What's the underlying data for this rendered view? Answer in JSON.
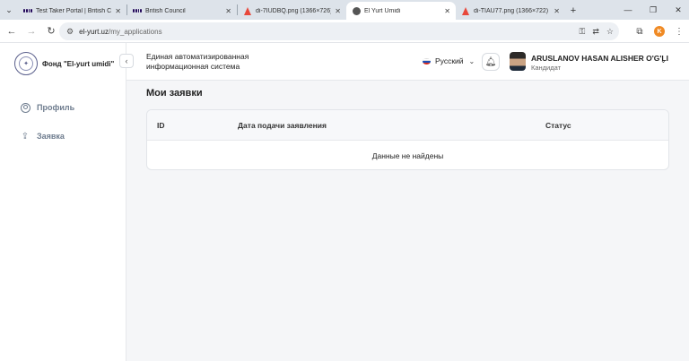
{
  "browser": {
    "tabs": [
      {
        "title": "Test Taker Portal | British Cou",
        "favicon": "british-council-icon",
        "active": false
      },
      {
        "title": "British Council",
        "favicon": "british-council-icon",
        "active": false
      },
      {
        "title": "di-7IUDBQ.png (1366×726)",
        "favicon": "pdf-icon",
        "active": false
      },
      {
        "title": "El Yurt Umidi",
        "favicon": "el-yurt-icon",
        "active": true
      },
      {
        "title": "di-TIAU77.png (1366×722)",
        "favicon": "pdf-icon",
        "active": false
      }
    ],
    "url_host": "el-yurt.uz",
    "url_path": "/my_applications",
    "profile_initial": "K"
  },
  "sidebar": {
    "brand": "Фонд \"El-yurt umidi\"",
    "items": [
      {
        "label": "Профиль",
        "icon": "user-circle-icon"
      },
      {
        "label": "Заявка",
        "icon": "upload-icon"
      }
    ]
  },
  "header": {
    "system_title": "Единая автоматизированная информационная система",
    "language": "Русский",
    "user_name": "ARUSLANOV HASAN ALISHER O'G'LI",
    "user_role": "Кандидат"
  },
  "main": {
    "page_title": "Мои заявки",
    "table": {
      "columns": [
        "ID",
        "Дата подачи заявления",
        "Статус"
      ],
      "empty_text": "Данные не найдены"
    }
  },
  "colors": {
    "accent_orange": "#f08a24",
    "nav_text": "#6e7c8e",
    "page_bg": "#f5f6f8"
  }
}
